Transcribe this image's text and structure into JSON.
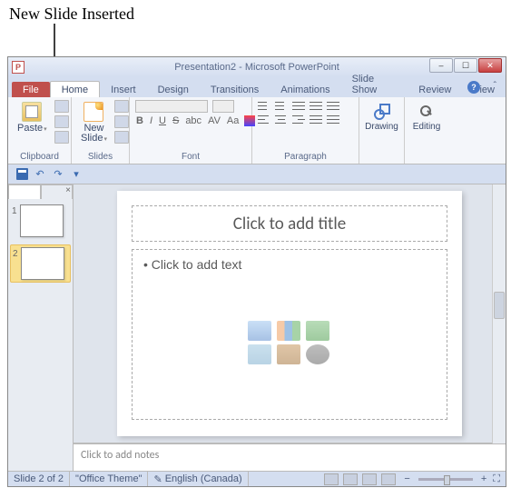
{
  "annotation": {
    "label": "New Slide Inserted"
  },
  "window": {
    "title": "Presentation2 - Microsoft PowerPoint",
    "controls": {
      "min": "–",
      "max": "☐",
      "close": "✕"
    }
  },
  "tabs": {
    "file": "File",
    "items": [
      "Home",
      "Insert",
      "Design",
      "Transitions",
      "Animations",
      "Slide Show",
      "Review",
      "View"
    ],
    "active": "Home",
    "help": "?",
    "collapse": "ˆ"
  },
  "ribbon": {
    "clipboard": {
      "label": "Clipboard",
      "paste": "Paste"
    },
    "slides": {
      "label": "Slides",
      "newslide_l1": "New",
      "newslide_l2": "Slide"
    },
    "font": {
      "label": "Font",
      "b": "B",
      "i": "I",
      "u": "U",
      "s": "S",
      "shadow": "abc",
      "aa": "Aa",
      "av": "AV"
    },
    "paragraph": {
      "label": "Paragraph"
    },
    "drawing": {
      "label": "Drawing"
    },
    "editing": {
      "label": "Editing"
    }
  },
  "qat": {
    "undo": "↶",
    "redo": "↷",
    "drop": "▾"
  },
  "panel": {
    "tab_slides": "",
    "tab_outline": "",
    "close": "×"
  },
  "thumbs": [
    {
      "num": "1",
      "selected": false
    },
    {
      "num": "2",
      "selected": true
    }
  ],
  "slide": {
    "title_placeholder": "Click to add title",
    "content_bullet": "• Click to add text"
  },
  "notes": {
    "placeholder": "Click to add notes"
  },
  "status": {
    "slide_info": "Slide 2 of 2",
    "theme": "\"Office Theme\"",
    "lang": "English (Canada)",
    "lang_icon": "✎",
    "zoom_minus": "−",
    "zoom_plus": "+",
    "fit": "⛶"
  }
}
